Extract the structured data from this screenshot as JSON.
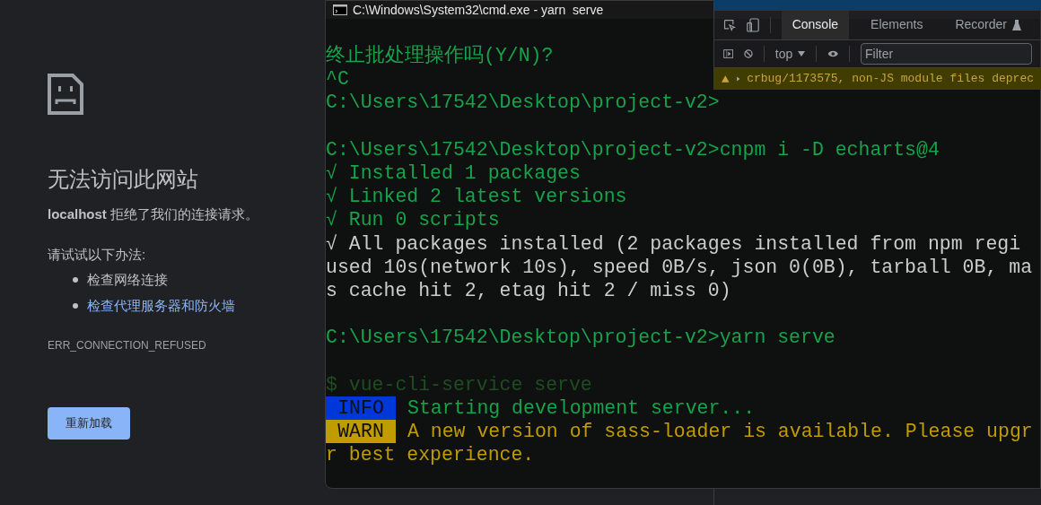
{
  "error_page": {
    "title": "无法访问此网站",
    "message": "**localhost** 拒绝了我们的连接请求。",
    "suggestions_heading": "请试试以下办法:",
    "suggestions": [
      {
        "text": "检查网络连接",
        "kind": "text"
      },
      {
        "text": "检查代理服务器和防火墙",
        "kind": "link"
      }
    ],
    "error_code": "ERR_CONNECTION_REFUSED",
    "reload_button": "重新加载"
  },
  "devtools": {
    "tabs": [
      {
        "label": "Console",
        "selected": true
      },
      {
        "label": "Elements",
        "selected": false
      },
      {
        "label": "Recorder",
        "selected": false
      }
    ],
    "context": "top",
    "filter_placeholder": "Filter",
    "messages": [
      {
        "text": "crbug/1173575, non-JS module files deprec",
        "kind": "warning"
      }
    ]
  },
  "terminal": {
    "title": "C:\\Windows\\System32\\cmd.exe - yarn  serve",
    "lines": [
      {
        "kind": "text",
        "segments": [
          {
            "text": "终止批处理操作吗(Y/N)?",
            "kind": "output"
          }
        ]
      },
      {
        "kind": "text",
        "segments": [
          {
            "text": "^C",
            "kind": "output"
          }
        ]
      },
      {
        "kind": "text",
        "segments": [
          {
            "text": "C:\\Users\\17542\\Desktop\\project-v2>",
            "kind": "output"
          }
        ]
      },
      {
        "kind": "blank"
      },
      {
        "kind": "text",
        "segments": [
          {
            "text": "C:\\Users\\17542\\Desktop\\project-v2>cnpm i -D echarts@4",
            "kind": "output"
          }
        ]
      },
      {
        "kind": "text",
        "segments": [
          {
            "text": "√ Installed 1 packages",
            "kind": "output"
          }
        ]
      },
      {
        "kind": "text",
        "segments": [
          {
            "text": "√ Linked 2 latest versions",
            "kind": "output"
          }
        ]
      },
      {
        "kind": "text",
        "segments": [
          {
            "text": "√ Run 0 scripts",
            "kind": "output"
          }
        ]
      },
      {
        "kind": "text",
        "segments": [
          {
            "text": "√ All packages installed (2 packages installed from npm regi",
            "kind": "plain"
          }
        ]
      },
      {
        "kind": "text",
        "segments": [
          {
            "text": "used 10s(network 10s), speed 0B/s, json 0(0B), tarball 0B, ma",
            "kind": "plain"
          }
        ]
      },
      {
        "kind": "text",
        "segments": [
          {
            "text": "s cache hit 2, etag hit 2 / miss 0)",
            "kind": "plain"
          }
        ]
      },
      {
        "kind": "blank"
      },
      {
        "kind": "text",
        "segments": [
          {
            "text": "C:\\Users\\17542\\Desktop\\project-v2>yarn serve",
            "kind": "output"
          }
        ]
      },
      {
        "kind": "blank"
      },
      {
        "kind": "text",
        "segments": [
          {
            "text": "$ vue-cli-service serve",
            "kind": "dim"
          }
        ]
      },
      {
        "kind": "text",
        "segments": [
          {
            "text": "INFO",
            "kind": "info_badge"
          },
          {
            "text": "Starting development server...",
            "kind": "output"
          }
        ]
      },
      {
        "kind": "text",
        "segments": [
          {
            "text": "WARN",
            "kind": "warn_badge"
          },
          {
            "text": "A new version of sass-loader is available. Please upgr",
            "kind": "warning"
          }
        ]
      },
      {
        "kind": "text",
        "segments": [
          {
            "text": "r best experience.",
            "kind": "warning"
          }
        ]
      }
    ]
  }
}
